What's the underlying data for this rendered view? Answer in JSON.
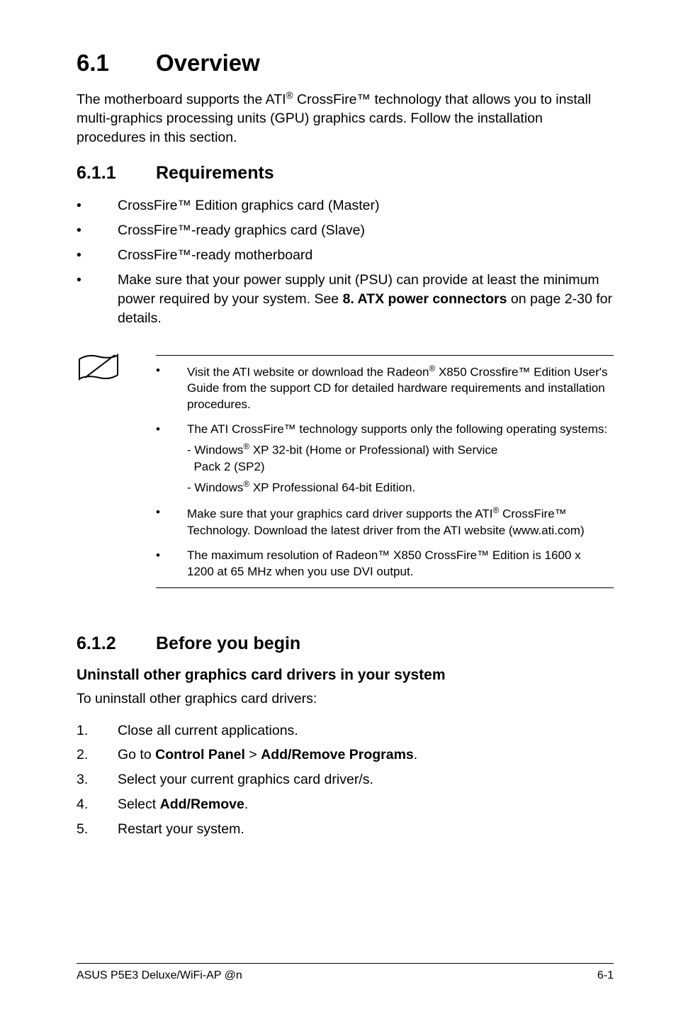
{
  "h1": {
    "num": "6.1",
    "title": "Overview"
  },
  "intro_parts": {
    "a": "The motherboard supports the ATI",
    "b": " CrossFire™ technology that allows you to install multi-graphics processing units (GPU) graphics cards. Follow the installation procedures in this section."
  },
  "h2_req": {
    "num": "6.1.1",
    "title": "Requirements"
  },
  "req_bullets": [
    "CrossFire™ Edition graphics card (Master)",
    "CrossFire™-ready graphics card (Slave)",
    "CrossFire™-ready motherboard"
  ],
  "req_bullet_psu": {
    "a": "Make sure that your power supply unit (PSU) can provide at least the minimum power required by your system. See ",
    "b": "8. ATX power connectors",
    "c": " on page 2-30 for details."
  },
  "notes": {
    "n1": {
      "a": "Visit the ATI website or download the Radeon",
      "b": " X850 Crossfire™ Edition User's Guide from the support CD for detailed hardware requirements and installation procedures."
    },
    "n2": "The ATI CrossFire™ technology supports only the following operating systems:",
    "n2_sub1": {
      "a": "- Windows",
      "b": " XP 32-bit  (Home or Professional) with Service",
      "c": "  Pack 2 (SP2)"
    },
    "n2_sub2": {
      "a": "- Windows",
      "b": " XP Professional 64-bit Edition."
    },
    "n3": {
      "a": "Make sure that your graphics card driver supports the ATI",
      "b": " CrossFire™ Technology. Download the latest driver from the ATI website (www.ati.com)"
    },
    "n4": "The maximum resolution of Radeon™ X850 CrossFire™ Edition is 1600 x 1200 at 65 MHz when you use DVI output."
  },
  "h2_before": {
    "num": "6.1.2",
    "title": "Before you begin"
  },
  "h3_uninstall": "Uninstall other graphics card drivers in your system",
  "uninstall_lead": "To uninstall other graphics card drivers:",
  "steps": {
    "s1": "Close all current applications.",
    "s2": {
      "a": "Go to ",
      "b": "Control Panel",
      "c": " > ",
      "d": "Add/Remove Programs",
      "e": "."
    },
    "s3": "Select your current graphics card driver/s.",
    "s4": {
      "a": "Select ",
      "b": "Add/Remove",
      "c": "."
    },
    "s5": "Restart your system."
  },
  "footer": {
    "left": "ASUS P5E3 Deluxe/WiFi-AP @n",
    "right": "6-1"
  },
  "sup_reg": "®"
}
